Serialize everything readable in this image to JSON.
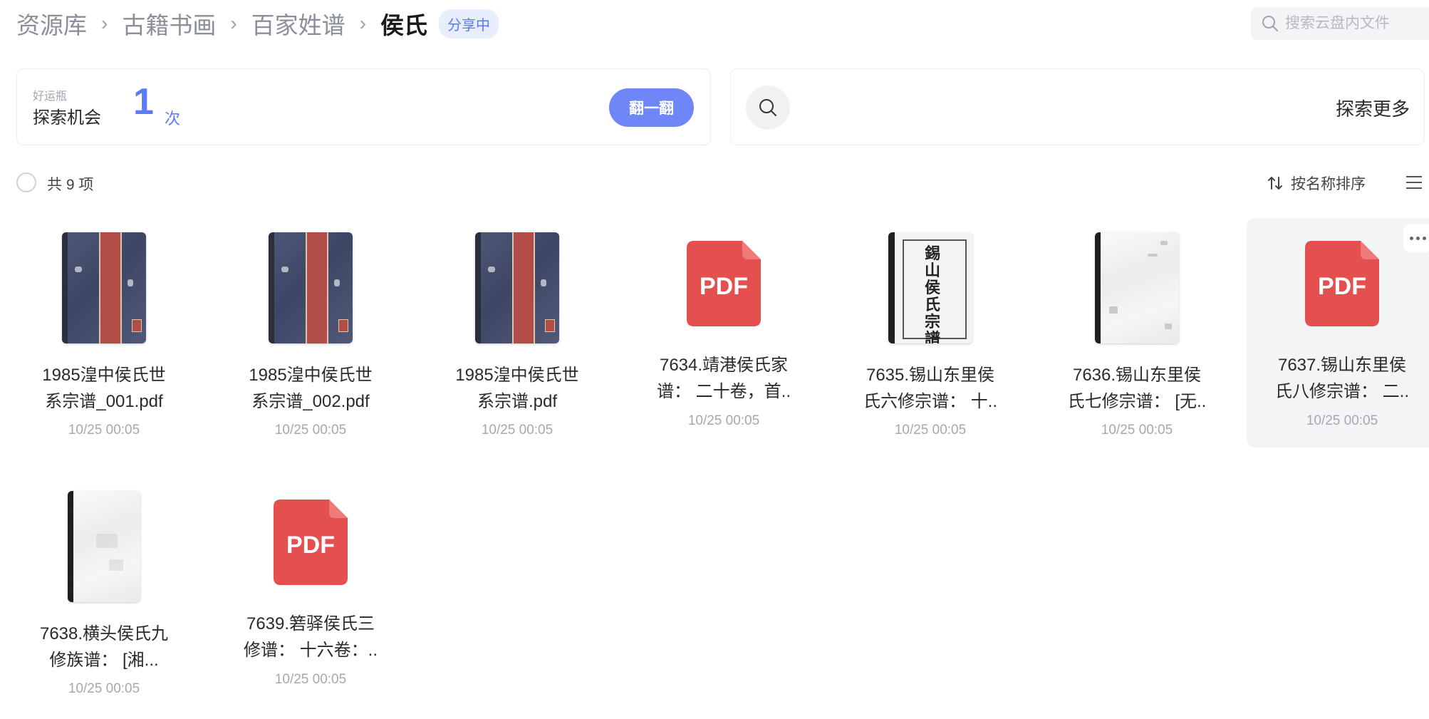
{
  "breadcrumb": {
    "items": [
      "资源库",
      "古籍书画",
      "百家姓谱"
    ],
    "current": "侯氏",
    "badge": "分享中"
  },
  "search": {
    "placeholder": "搜索云盘内文件",
    "icon": "search-icon"
  },
  "lucky_card": {
    "small_label": "好运瓶",
    "title": "探索机会",
    "count": "1",
    "unit": "次",
    "button": "翻一翻"
  },
  "explore_card": {
    "label": "探索更多",
    "icon": "search-icon"
  },
  "toolbar": {
    "count_label": "共 9 项",
    "sort_label": "按名称排序",
    "view_icon": "list-icon"
  },
  "colors": {
    "accent": "#5b7bff",
    "button": "#6e86f7",
    "pdf": "#e4504f"
  },
  "files": [
    {
      "name_line1": "1985湟中侯氏世",
      "name_line2": "系宗谱_001.pdf",
      "date": "10/25 00:05",
      "thumb": "blue-cover"
    },
    {
      "name_line1": "1985湟中侯氏世",
      "name_line2": "系宗谱_002.pdf",
      "date": "10/25 00:05",
      "thumb": "blue-cover"
    },
    {
      "name_line1": "1985湟中侯氏世",
      "name_line2": "系宗谱.pdf",
      "date": "10/25 00:05",
      "thumb": "blue-cover"
    },
    {
      "name_line1": "7634.靖港侯氏家",
      "name_line2": "谱： 二十卷，首..",
      "date": "10/25 00:05",
      "thumb": "pdf-icon"
    },
    {
      "name_line1": "7635.锡山东里侯",
      "name_line2": "氏六修宗谱： 十..",
      "date": "10/25 00:05",
      "thumb": "white-cover",
      "cover_text": "錫山侯氏宗譜"
    },
    {
      "name_line1": "7636.锡山东里侯",
      "name_line2": "氏七修宗谱： [无..",
      "date": "10/25 00:05",
      "thumb": "pale-cover"
    },
    {
      "name_line1": "7637.锡山东里侯",
      "name_line2": "氏八修宗谱： 二..",
      "date": "10/25 00:05",
      "thumb": "pdf-icon"
    },
    {
      "name_line1": "7638.横头侯氏九",
      "name_line2": "修族谱： [湘...",
      "date": "10/25 00:05",
      "thumb": "pale-cover"
    },
    {
      "name_line1": "7639.箬驿侯氏三",
      "name_line2": "修谱： 十六卷：..",
      "date": "10/25 00:05",
      "thumb": "pdf-icon"
    }
  ],
  "pdf_label": "PDF"
}
